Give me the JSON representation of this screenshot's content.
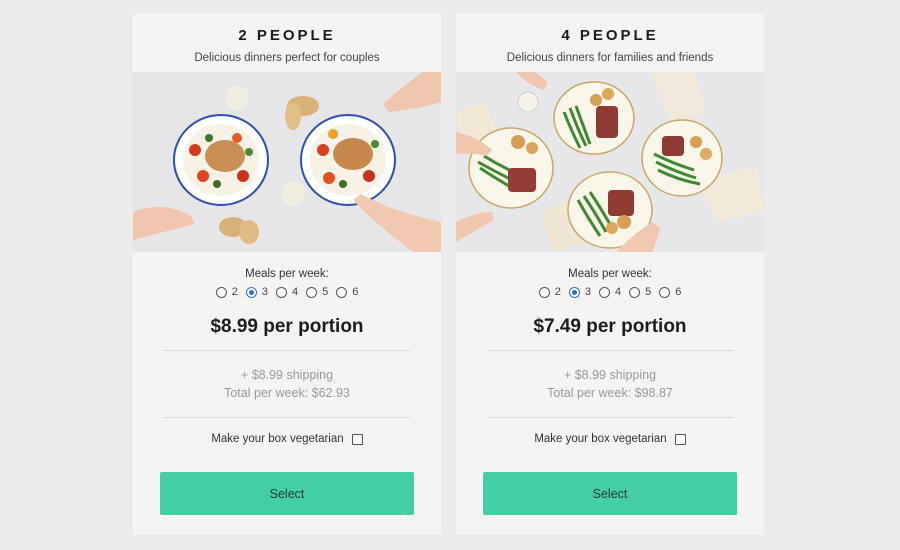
{
  "plans": [
    {
      "title": "2 PEOPLE",
      "subtitle": "Delicious dinners perfect for couples",
      "photo_name": "two-plate-chicken-photo",
      "meals_label": "Meals per week:",
      "meal_options": [
        "2",
        "3",
        "4",
        "5",
        "6"
      ],
      "selected_meals": "3",
      "price": "$8.99 per portion",
      "shipping": "+ $8.99 shipping",
      "total": "Total per week: $62.93",
      "vegetarian_label": "Make your box vegetarian",
      "vegetarian_checked": false,
      "select_label": "Select"
    },
    {
      "title": "4 PEOPLE",
      "subtitle": "Delicious dinners for families and friends",
      "photo_name": "four-plate-steak-photo",
      "meals_label": "Meals per week:",
      "meal_options": [
        "2",
        "3",
        "4",
        "5",
        "6"
      ],
      "selected_meals": "3",
      "price": "$7.49 per portion",
      "shipping": "+ $8.99 shipping",
      "total": "Total per week: $98.87",
      "vegetarian_label": "Make your box vegetarian",
      "vegetarian_checked": false,
      "select_label": "Select"
    }
  ],
  "colors": {
    "page_background": "#ebebeb",
    "card_background": "#f4f4f4",
    "button": "#43cfa3",
    "radio_selected": "#2b6fd6"
  }
}
